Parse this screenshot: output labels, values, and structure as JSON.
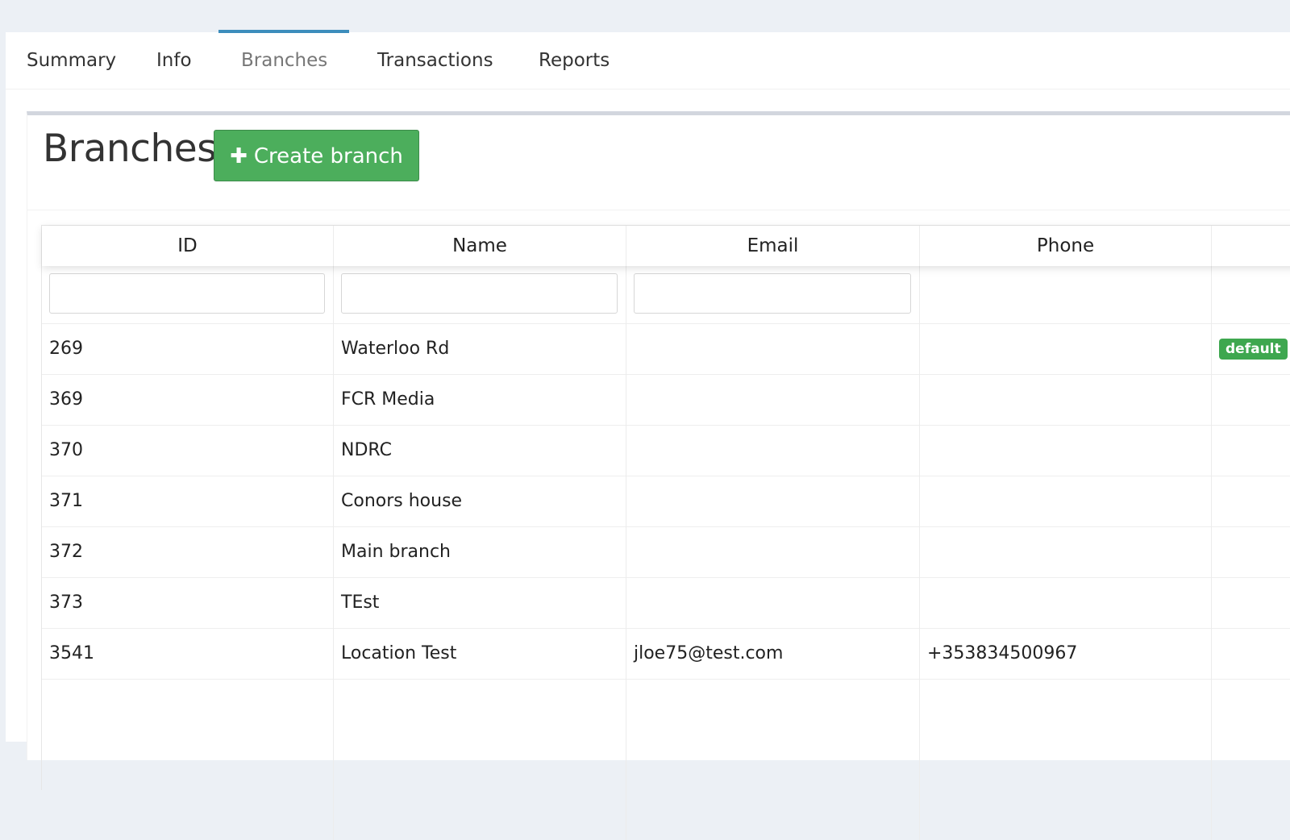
{
  "tabs": [
    {
      "label": "Summary",
      "active": false
    },
    {
      "label": "Info",
      "active": false
    },
    {
      "label": "Branches",
      "active": true
    },
    {
      "label": "Transactions",
      "active": false
    },
    {
      "label": "Reports",
      "active": false
    }
  ],
  "box": {
    "title": "Branches",
    "create_button_icon": "plus-icon",
    "create_button_label": "Create branch"
  },
  "table": {
    "columns": [
      "ID",
      "Name",
      "Email",
      "Phone",
      ""
    ],
    "filters": {
      "id": "",
      "name": "",
      "email": ""
    },
    "rows": [
      {
        "id": "269",
        "name": "Waterloo Rd",
        "email": "",
        "phone": "",
        "badge": "default"
      },
      {
        "id": "369",
        "name": "FCR Media",
        "email": "",
        "phone": "",
        "badge": ""
      },
      {
        "id": "370",
        "name": "NDRC",
        "email": "",
        "phone": "",
        "badge": ""
      },
      {
        "id": "371",
        "name": "Conors house",
        "email": "",
        "phone": "",
        "badge": ""
      },
      {
        "id": "372",
        "name": "Main branch",
        "email": "",
        "phone": "",
        "badge": ""
      },
      {
        "id": "373",
        "name": "TEst",
        "email": "",
        "phone": "",
        "badge": ""
      },
      {
        "id": "3541",
        "name": "Location Test",
        "email": "jloe75@test.com",
        "phone": "+353834500967",
        "badge": ""
      }
    ]
  },
  "colors": {
    "active_tab_accent": "#3c8dbc",
    "create_button": "#4cae5c",
    "badge": "#3ea74f"
  }
}
